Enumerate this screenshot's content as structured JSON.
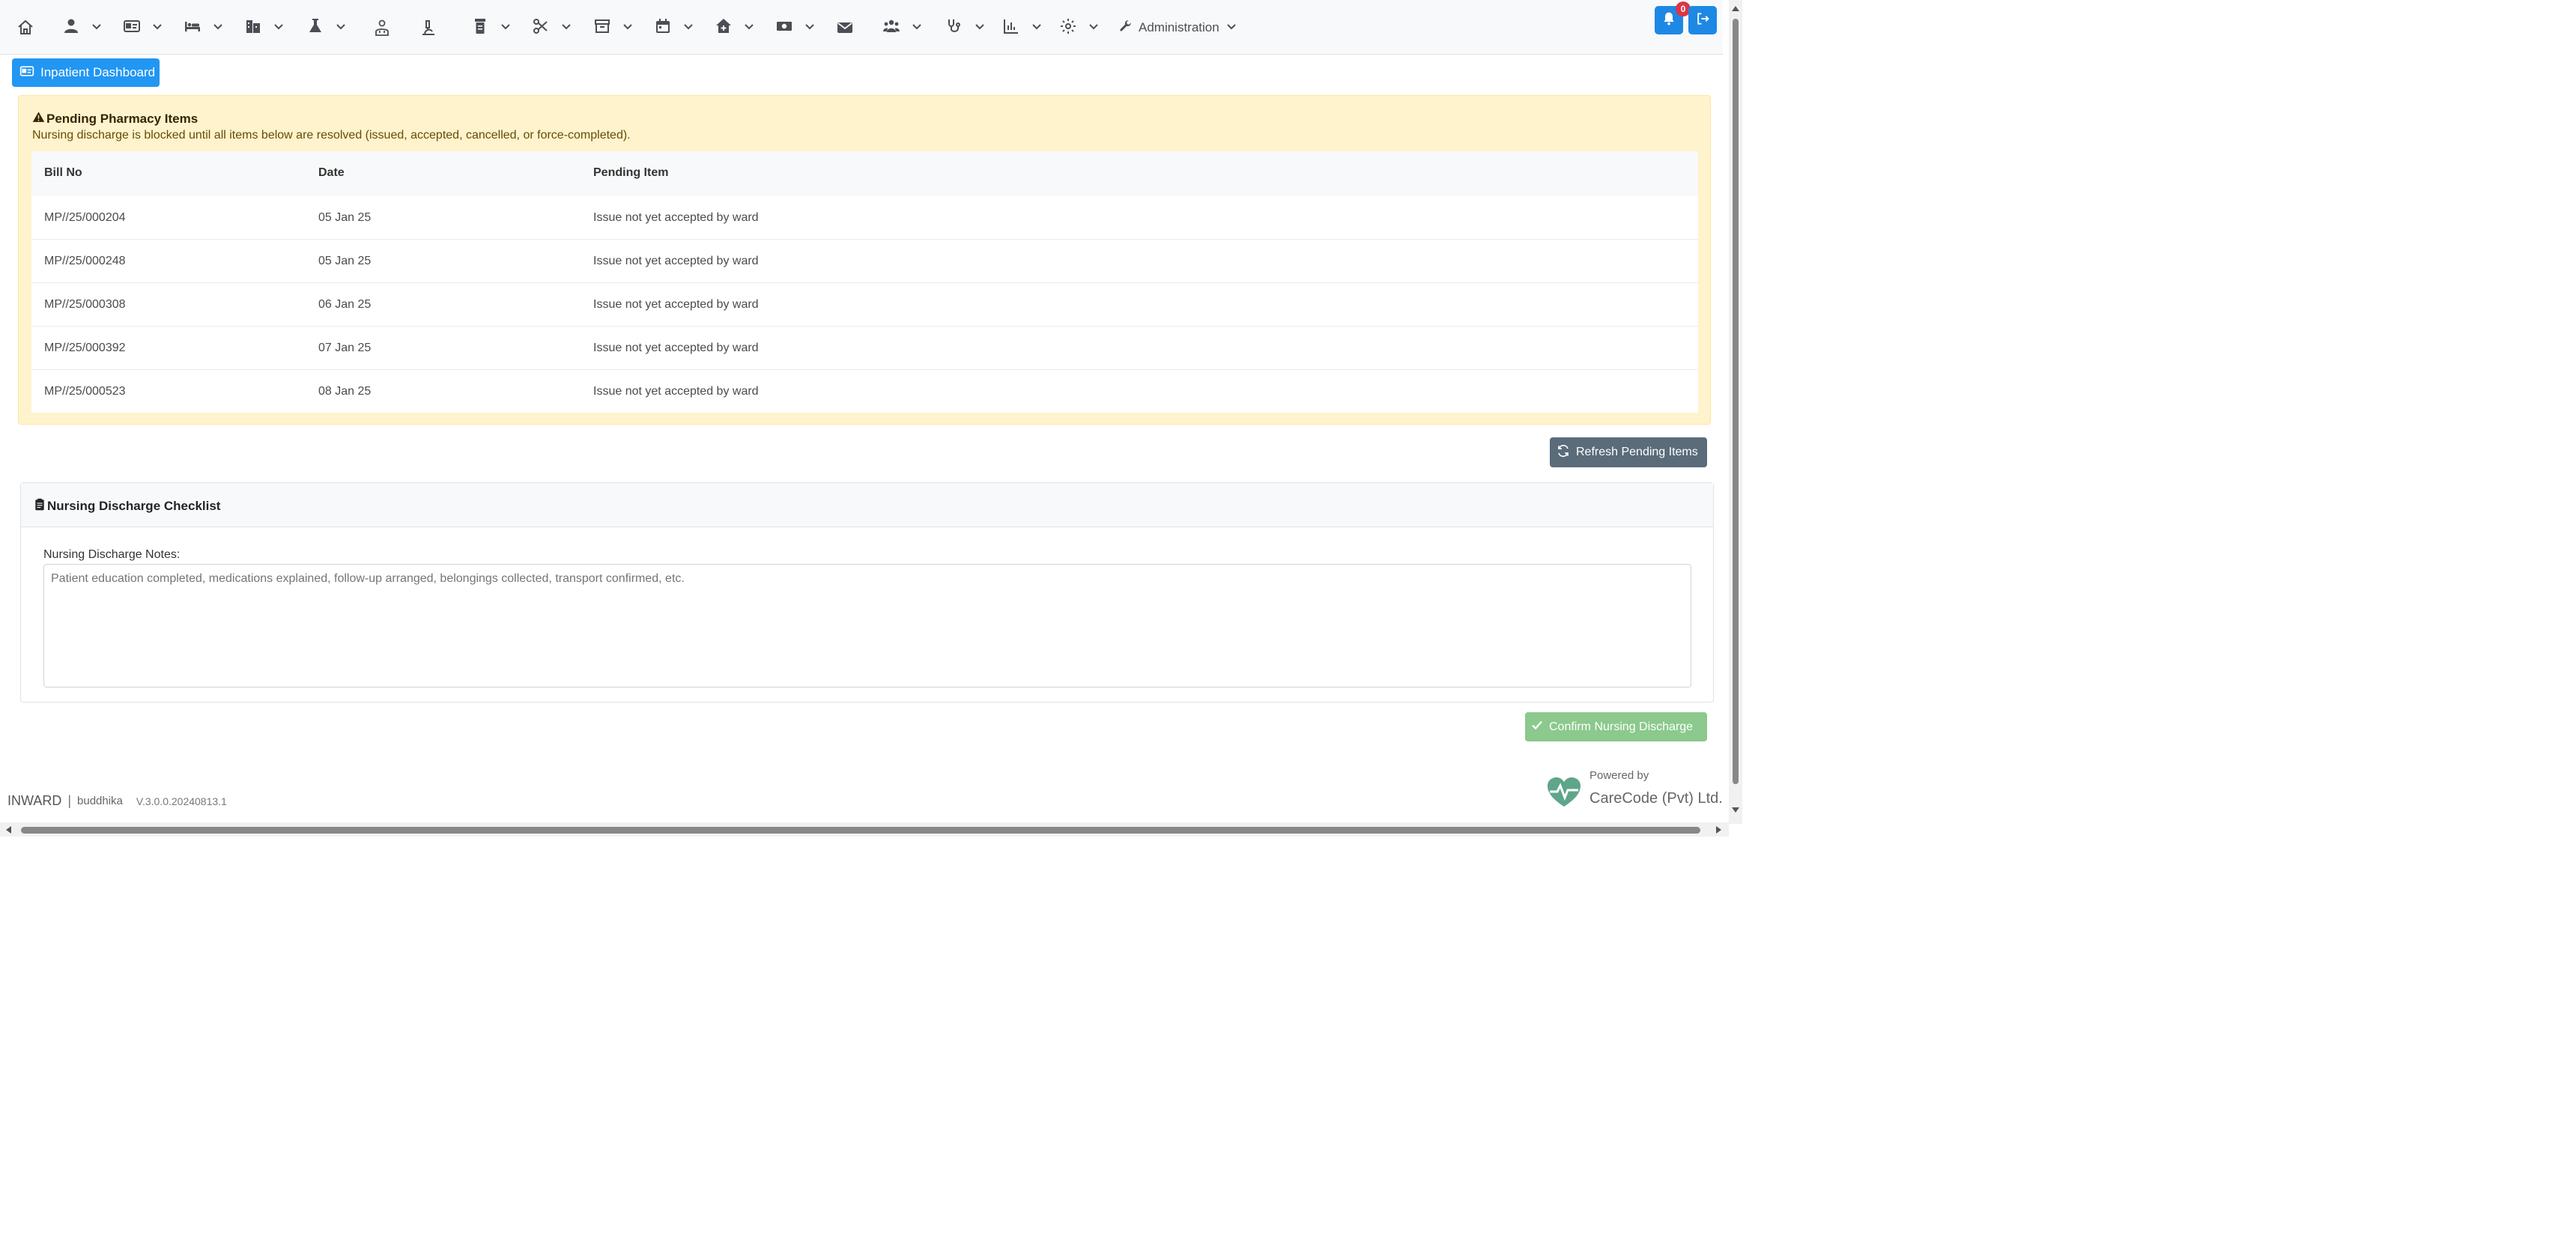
{
  "navbar": {
    "icons": [
      "home-icon",
      "user-icon",
      "id-card-icon",
      "bed-icon",
      "building-icon",
      "flask-icon",
      "doctor-icon",
      "microscope-icon",
      "prescription-bottle-icon",
      "scissors-icon",
      "store-icon",
      "calendar-icon",
      "clinic-icon",
      "money-icon",
      "envelope-icon",
      "users-icon",
      "stethoscope-icon",
      "chart-icon",
      "gear-icon"
    ],
    "administration_label": "Administration",
    "notification_count": "0"
  },
  "dashboard_button": {
    "label": "Inpatient Dashboard"
  },
  "pending": {
    "title": "Pending Pharmacy Items",
    "subtitle": "Nursing discharge is blocked until all items below are resolved (issued, accepted, cancelled, or force-completed).",
    "columns": [
      "Bill No",
      "Date",
      "Pending Item"
    ],
    "rows": [
      {
        "bill_no": "MP//25/000204",
        "date": "05 Jan 25",
        "item": "Issue not yet accepted by ward"
      },
      {
        "bill_no": "MP//25/000248",
        "date": "05 Jan 25",
        "item": "Issue not yet accepted by ward"
      },
      {
        "bill_no": "MP//25/000308",
        "date": "06 Jan 25",
        "item": "Issue not yet accepted by ward"
      },
      {
        "bill_no": "MP//25/000392",
        "date": "07 Jan 25",
        "item": "Issue not yet accepted by ward"
      },
      {
        "bill_no": "MP//25/000523",
        "date": "08 Jan 25",
        "item": "Issue not yet accepted by ward"
      }
    ]
  },
  "refresh_button": {
    "label": "Refresh Pending Items"
  },
  "checklist": {
    "title": "Nursing Discharge Checklist",
    "notes_label": "Nursing Discharge Notes:",
    "notes_placeholder": "Patient education completed, medications explained, follow-up arranged, belongings collected, transport confirmed, etc.",
    "notes_value": ""
  },
  "confirm_button": {
    "label": "Confirm Nursing Discharge"
  },
  "footer": {
    "module": "INWARD",
    "separator": "|",
    "user": "buddhika",
    "version": "V.3.0.0.20240813.1",
    "powered_by": "Powered by",
    "company": "CareCode (Pvt) Ltd."
  },
  "colors": {
    "primary": "#2196f3",
    "alert_bg": "#fff3cd",
    "refresh_btn": "#5a6b7a",
    "confirm_btn": "#8bc98d",
    "badge": "#dc3545"
  }
}
